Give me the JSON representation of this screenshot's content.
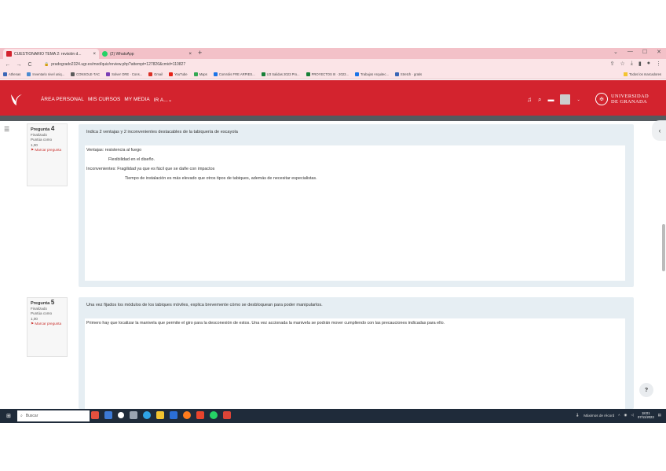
{
  "browser": {
    "tabs": [
      {
        "label": "CUESTIONARIO TEMA 2: revisión d...",
        "close": "×",
        "active": true
      },
      {
        "label": "(2) WhatsApp",
        "close": "×",
        "active": false
      }
    ],
    "new_tab": "+",
    "window_controls": {
      "dropdown": "⌄",
      "minimize": "—",
      "maximize": "☐",
      "close": "✕"
    },
    "nav": {
      "back": "←",
      "forward": "→",
      "reload": "C"
    },
    "url": "pradogrado2324.ugr.es/mod/quiz/review.php?attempt=127826&cmid=110827",
    "bookmarks": [
      {
        "label": "Athenas",
        "color": "#3a66b6"
      },
      {
        "label": "Inventario nivel uniq...",
        "color": "#4a8bd0"
      },
      {
        "label": "CONSOLE-TAC",
        "color": "#5c5c5c"
      },
      {
        "label": "Solver ORE · Cons...",
        "color": "#7b3fb5"
      },
      {
        "label": "Gmail",
        "color": "#d93025"
      },
      {
        "label": "YouTube",
        "color": "#e62117"
      },
      {
        "label": "Maps",
        "color": "#34a853"
      },
      {
        "label": "Comrolis FRE ARPIES...",
        "color": "#1a73e8"
      },
      {
        "label": "U3 Salidas 2023 Pro...",
        "color": "#188038"
      },
      {
        "label": "PROYECTOS III · 2023...",
        "color": "#188038"
      },
      {
        "label": "Trabajos Arquitec...",
        "color": "#1a73e8"
      },
      {
        "label": "Stretch · gratis",
        "color": "#3a66b6"
      }
    ],
    "other_bookmarks": "Todos los marcadores"
  },
  "site": {
    "nav": [
      "ÁREA PERSONAL",
      "MIS CURSOS",
      "MY MEDIA",
      "IR A...⌄"
    ],
    "university": [
      "UNIVERSIDAD",
      "DE GRANADA"
    ]
  },
  "questions": [
    {
      "number_label": "Pregunta",
      "number": "4",
      "state": "Finalizado",
      "mark_label": "Puntúa como",
      "mark": "1,00",
      "flag": "Marcar pregunta",
      "prompt": "Indica 2 ventajas y 2 inconvenientes destacables de la tabiquería de escayola",
      "answer_lines": [
        "Ventajas: resistencia al fuego",
        "Flexibilidad en el diseño.",
        "Inconvenientes: Fragilidad ya que es fácil que se dañe con impactos",
        "Tiempo de instalación es más elevado que otros tipos de tabiques, además de necesitar especialistas."
      ]
    },
    {
      "number_label": "Pregunta",
      "number": "5",
      "state": "Finalizado",
      "mark_label": "Puntúa como",
      "mark": "1,00",
      "flag": "Marcar pregunta",
      "prompt": "Una vez fijados los módulos de los tabiques móviles, explica brevemente cómo se desbloquean para poder manipularlos.",
      "answer_lines": [
        "Primero hay que localizar la manivela que permite el giro para la desconexión de estos. Una vez accionada la manivela se podrán mover cumpliendo con las precauciones indicadas para ello."
      ]
    }
  ],
  "help_label": "?",
  "taskbar": {
    "search_placeholder": "Buscar",
    "weather": "Máximos de récord",
    "time": "18:01",
    "date": "07/11/2023"
  }
}
